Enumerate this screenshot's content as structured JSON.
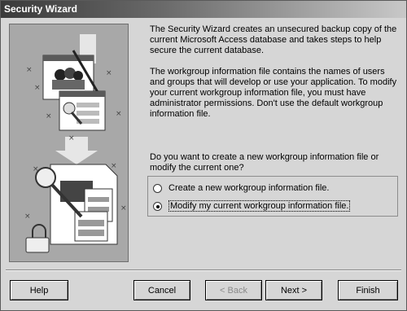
{
  "window": {
    "title": "Security Wizard"
  },
  "description": {
    "p1": "The Security Wizard creates an unsecured backup copy of the current Microsoft Access database and takes steps to help secure the current database.",
    "p2": "The workgroup information file contains the names of users and groups that will develop or use your application. To modify your current workgroup information file, you must have administrator permissions. Don't use the default workgroup information file."
  },
  "question": "Do you want to create a new workgroup information file or modify the current one?",
  "options": [
    {
      "label": "Create a new workgroup information file.",
      "selected": false
    },
    {
      "label": "Modify my current workgroup information file.",
      "selected": true
    }
  ],
  "buttons": {
    "help": "Help",
    "cancel": "Cancel",
    "back": "< Back",
    "next": "Next >",
    "finish": "Finish"
  }
}
